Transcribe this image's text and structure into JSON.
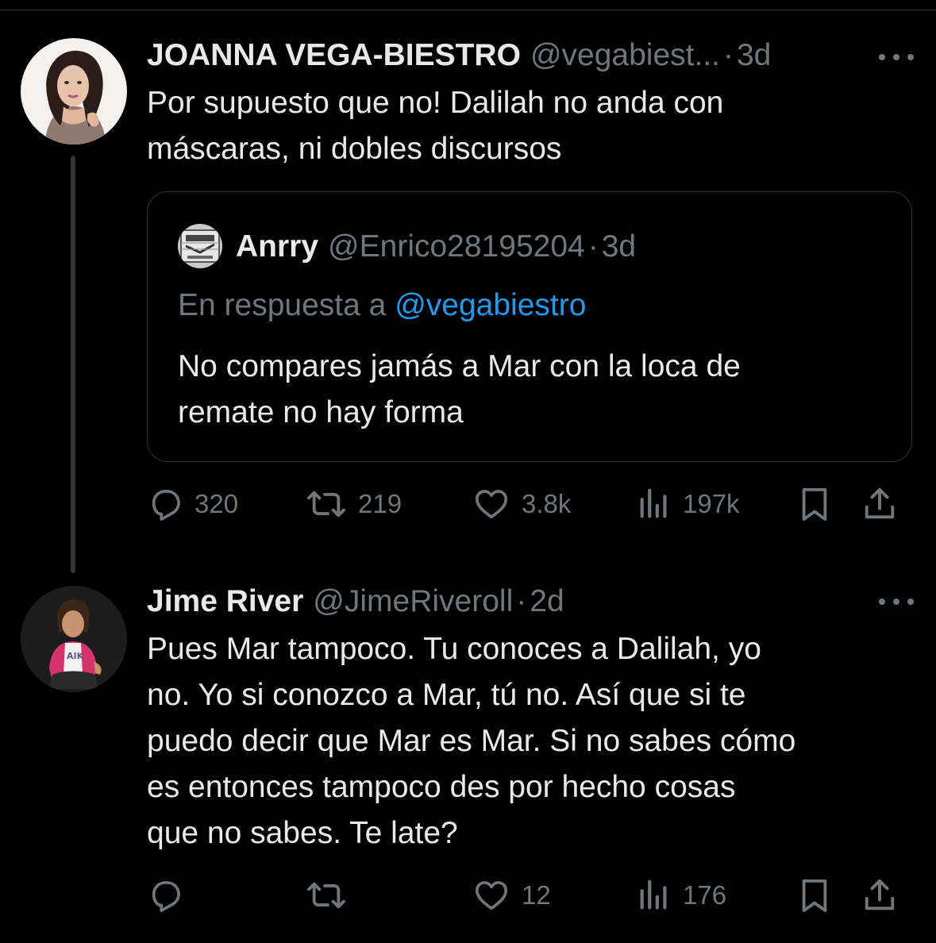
{
  "tweets": [
    {
      "author": {
        "name": "JOANNA VEGA-BIESTRO",
        "handle": "@vegabiest...",
        "avatar_icon": "profile-photo-woman"
      },
      "separator": "·",
      "time": "3d",
      "text": "Por supuesto que no! Dalilah no anda con\nmáscaras, ni dobles discursos",
      "quote": {
        "author": {
          "name": "Anrry",
          "handle": "@Enrico28195204",
          "avatar_icon": "profile-photo-logo"
        },
        "separator": "·",
        "time": "3d",
        "reply_prefix": "En respuesta a",
        "reply_to": "@vegabiestro",
        "text": "No compares jamás a Mar con la loca de\nremate no hay forma"
      },
      "stats": {
        "replies": "320",
        "retweets": "219",
        "likes": "3.8k",
        "views": "197k"
      }
    },
    {
      "author": {
        "name": "Jime River",
        "handle": "@JimeRiveroll",
        "avatar_icon": "profile-photo-woman-pink-jacket"
      },
      "separator": "·",
      "time": "2d",
      "text": "Pues Mar tampoco. Tu conoces a Dalilah, yo\nno. Yo si conozco a Mar, tú no. Así que si te\npuedo decir que Mar es Mar. Si no sabes cómo\nes entonces tampoco des por hecho cosas\nque no sabes. Te late?",
      "stats": {
        "replies": "",
        "retweets": "",
        "likes": "12",
        "views": "176"
      }
    }
  ],
  "colors": {
    "background": "#000000",
    "text_primary": "#e7e9ea",
    "text_secondary": "#71767b",
    "mention": "#1d9bf0",
    "border": "#2f3336"
  }
}
